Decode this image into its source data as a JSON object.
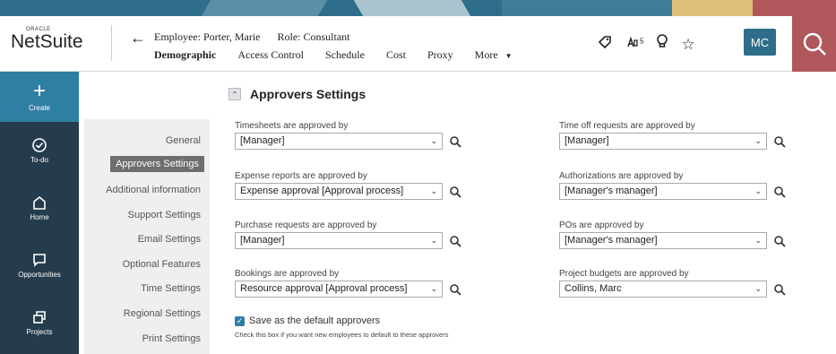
{
  "brand": {
    "small": "ORACLE",
    "name": "NetSuite"
  },
  "header": {
    "employee": "Employee: Porter, Marie",
    "role": "Role: Consultant",
    "badge_count": "5",
    "avatar_initials": "MC"
  },
  "tabs": [
    {
      "label": "Demographic",
      "active": true
    },
    {
      "label": "Access Control"
    },
    {
      "label": "Schedule"
    },
    {
      "label": "Cost"
    },
    {
      "label": "Proxy"
    },
    {
      "label": "More"
    }
  ],
  "leftnav": {
    "create": "Create",
    "items": [
      {
        "label": "To-do",
        "icon": "check-circle-icon"
      },
      {
        "label": "Home",
        "icon": "home-icon"
      },
      {
        "label": "Opportunities",
        "icon": "chat-icon"
      },
      {
        "label": "Projects",
        "icon": "projects-icon"
      }
    ]
  },
  "subnav": [
    {
      "label": "General"
    },
    {
      "label": "Approvers Settings",
      "active": true
    },
    {
      "label": "Additional information"
    },
    {
      "label": "Support Settings"
    },
    {
      "label": "Email Settings"
    },
    {
      "label": "Optional Features"
    },
    {
      "label": "Time Settings"
    },
    {
      "label": "Regional Settings"
    },
    {
      "label": "Print Settings"
    }
  ],
  "main": {
    "title": "Approvers Settings",
    "fields": [
      {
        "label": "Timesheets are approved by",
        "value": "[Manager]"
      },
      {
        "label": "Expense reports are approved by",
        "value": "Expense approval [Approval process]"
      },
      {
        "label": "Purchase requests are approved by",
        "value": "[Manager]"
      },
      {
        "label": "Bookings are approved by",
        "value": "Resource approval [Approval process]"
      },
      {
        "label": "Time off requests are approved by",
        "value": "[Manager]"
      },
      {
        "label": "Authorizations are approved by",
        "value": "[Manager's manager]"
      },
      {
        "label": "POs are approved by",
        "value": "[Manager's manager]"
      },
      {
        "label": "Project budgets are approved by",
        "value": "Collins, Marc"
      }
    ],
    "checkbox_label": "Save as the default approvers",
    "checkbox_checked": true,
    "checkbox_help": "Check this box if you want new employees to default to these approvers"
  },
  "colors": {
    "nav_bg": "#243c4c",
    "create_bg": "#2f7fa3",
    "avatar_bg": "#2e6e8a",
    "search_bg": "#b0575c",
    "active_subnav": "#6e6e6e"
  }
}
